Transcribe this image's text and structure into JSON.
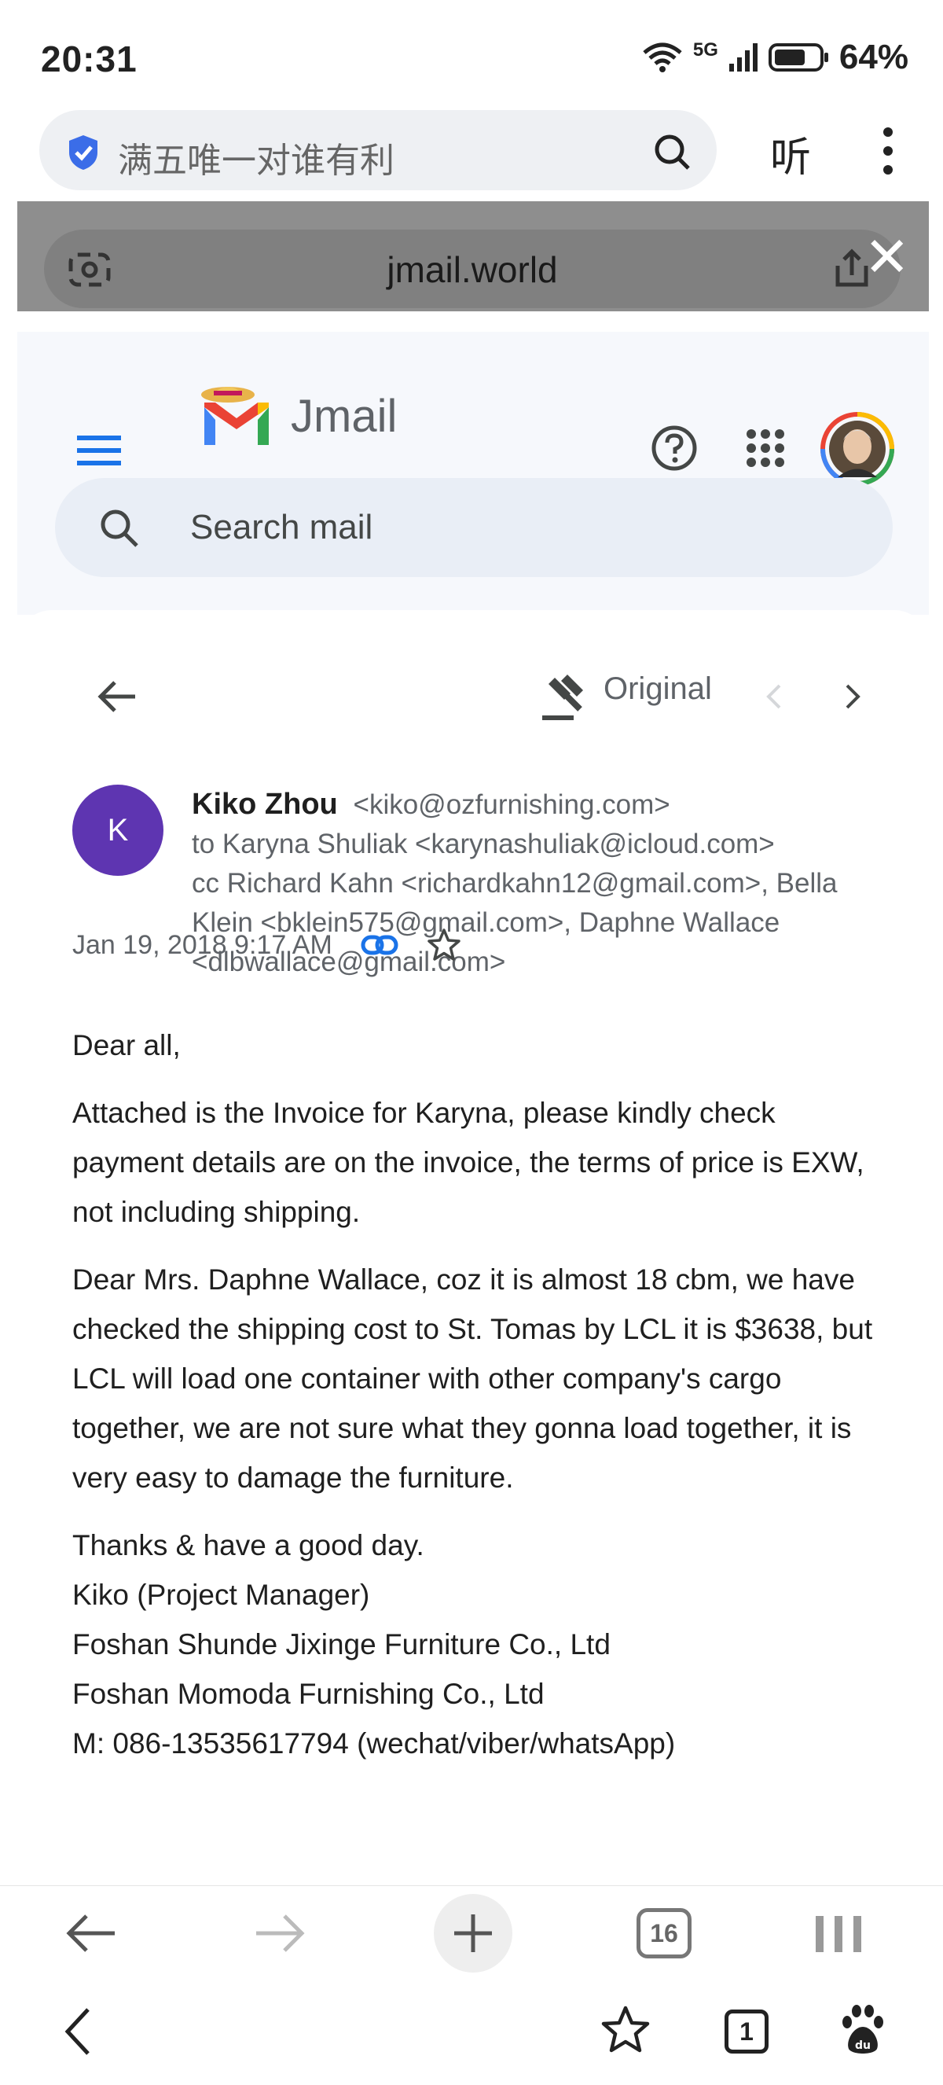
{
  "status_bar": {
    "time": "20:31",
    "network": "5G",
    "battery": "64%"
  },
  "browser": {
    "omnibox_text": "满五唯一对谁有利",
    "listen_label": "听"
  },
  "page": {
    "url": "jmail.world"
  },
  "jmail": {
    "brand": "Jmail",
    "search_placeholder": "Search mail"
  },
  "email": {
    "view_mode": "Original",
    "avatar_letter": "K",
    "sender_name": "Kiko Zhou",
    "sender_email": "<kiko@ozfurnishing.com>",
    "to_line": "to Karyna Shuliak <karynashuliak@icloud.com>",
    "cc_line": "cc Richard Kahn <richardkahn12@gmail.com>, Bella Klein <bklein575@gmail.com>, Daphne Wallace <dlbwallace@gmail.com>",
    "date": "Jan 19, 2018 9:17 AM",
    "body": {
      "greeting": "Dear all,",
      "p1": "Attached is the Invoice for Karyna, please kindly check payment details are on the invoice, the terms of price is EXW, not including shipping.",
      "p2": "Dear Mrs. Daphne Wallace, coz it is almost 18 cbm, we have checked the shipping cost to St. Tomas by LCL it is $3638, but LCL will load one container with other company's cargo together, we are not sure what they gonna load together, it is very easy to damage the furniture.",
      "sig_line1": "Thanks & have a good day.",
      "sig_line2": "Kiko (Project Manager)",
      "sig_line3": "Foshan Shunde Jixinge Furniture Co., Ltd",
      "sig_line4": "Foshan Momoda Furnishing Co., Ltd",
      "sig_line5": "M: 086-13535617794 (wechat/viber/whatsApp)"
    }
  },
  "bottom_nav": {
    "tab_count": "16"
  },
  "system_nav": {
    "window_count": "1"
  },
  "colors": {
    "avatar_bg": "#5e35b1",
    "link_icon": "#1a73e8",
    "overlay": "#8e8e8e"
  }
}
